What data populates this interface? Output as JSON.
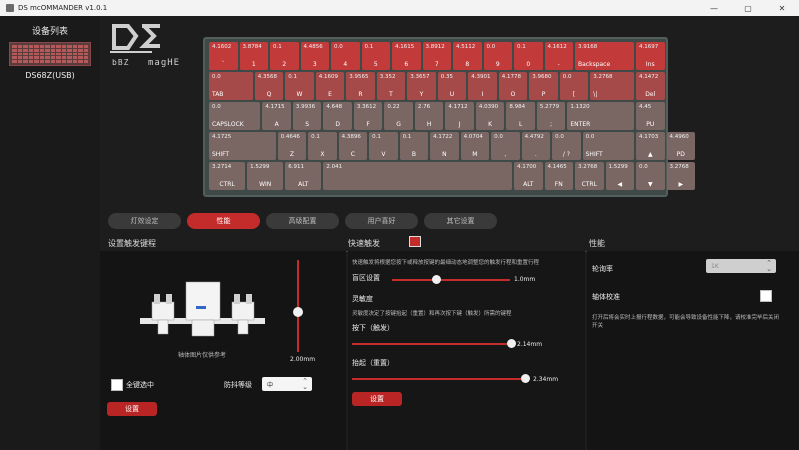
{
  "window": {
    "title": "DS mcOMMANDER v1.0.1",
    "minimize": "—",
    "maximize": "▢",
    "close": "✕"
  },
  "sidebar": {
    "heading": "设备列表",
    "device_name": "DS68Z(USB)"
  },
  "logo": {
    "small_text": "bBZ",
    "brand_text": "magHE"
  },
  "keyboard": {
    "row1": [
      {
        "v": "4.1602",
        "l": "`"
      },
      {
        "v": "3.8784",
        "l": "1"
      },
      {
        "v": "0.1",
        "l": "2"
      },
      {
        "v": "4.4856",
        "l": "3"
      },
      {
        "v": "0.0",
        "l": "4"
      },
      {
        "v": "0.1",
        "l": "5"
      },
      {
        "v": "4.1615",
        "l": "6"
      },
      {
        "v": "3.8912",
        "l": "7"
      },
      {
        "v": "4.5112",
        "l": "8"
      },
      {
        "v": "0.0",
        "l": "9"
      },
      {
        "v": "0.1",
        "l": "0"
      },
      {
        "v": "4.1612",
        "l": "-"
      },
      {
        "v": "3.9168",
        "l": "Backspace"
      },
      {
        "v": "4.1697",
        "l": "Ins"
      }
    ],
    "row2": [
      {
        "v": "0.0",
        "l": "TAB"
      },
      {
        "v": "4.3568",
        "l": "Q"
      },
      {
        "v": "0.1",
        "l": "W"
      },
      {
        "v": "4.1609",
        "l": "E"
      },
      {
        "v": "3.9565",
        "l": "R"
      },
      {
        "v": "3.352",
        "l": "T"
      },
      {
        "v": "3.3657",
        "l": "Y"
      },
      {
        "v": "0.35",
        "l": "U"
      },
      {
        "v": "4.3901",
        "l": "I"
      },
      {
        "v": "4.1778",
        "l": "O"
      },
      {
        "v": "3.9680",
        "l": "P"
      },
      {
        "v": "0.0",
        "l": "["
      },
      {
        "v": "3.2768",
        "l": "\\|"
      },
      {
        "v": "4.1472",
        "l": "Del"
      }
    ],
    "row3": [
      {
        "v": "0.0",
        "l": "CAPSLOCK"
      },
      {
        "v": "4.1715",
        "l": "A"
      },
      {
        "v": "3.9936",
        "l": "S"
      },
      {
        "v": "4.648",
        "l": "D"
      },
      {
        "v": "3.3612",
        "l": "F"
      },
      {
        "v": "0.22",
        "l": "G"
      },
      {
        "v": "2.76",
        "l": "H"
      },
      {
        "v": "4.1712",
        "l": "J"
      },
      {
        "v": "4.0390",
        "l": "K"
      },
      {
        "v": "8.984",
        "l": "L"
      },
      {
        "v": "5.2779",
        "l": ";"
      },
      {
        "v": "1.1320",
        "l": "ENTER"
      },
      {
        "v": "4.45",
        "l": "PU"
      }
    ],
    "row4": [
      {
        "v": "4.1725",
        "l": "SHIFT"
      },
      {
        "v": "0.4646",
        "l": "Z"
      },
      {
        "v": "0.1",
        "l": "X"
      },
      {
        "v": "4.3896",
        "l": "C"
      },
      {
        "v": "0.1",
        "l": "V"
      },
      {
        "v": "0.1",
        "l": "B"
      },
      {
        "v": "4.1722",
        "l": "N"
      },
      {
        "v": "4.0704",
        "l": "M"
      },
      {
        "v": "0.0",
        "l": ","
      },
      {
        "v": "4.4792",
        "l": "."
      },
      {
        "v": "0.0",
        "l": "/ ?"
      },
      {
        "v": "0.0",
        "l": "SHIFT"
      },
      {
        "v": "4.1703",
        "l": "▲"
      },
      {
        "v": "4.4960",
        "l": "PD"
      }
    ],
    "row5": [
      {
        "v": "3.2714",
        "l": "CTRL"
      },
      {
        "v": "1.5299",
        "l": "WIN"
      },
      {
        "v": "6.911",
        "l": "ALT"
      },
      {
        "v": "2.041",
        "l": ""
      },
      {
        "v": "4.1700",
        "l": "ALT"
      },
      {
        "v": "4.1465",
        "l": "FN"
      },
      {
        "v": "3.2768",
        "l": "CTRL"
      },
      {
        "v": "1.5299",
        "l": "◀"
      },
      {
        "v": "0.0",
        "l": "▼"
      },
      {
        "v": "3.2768",
        "l": "▶"
      }
    ]
  },
  "tabs": [
    {
      "label": "灯效设定"
    },
    {
      "label": "性能"
    },
    {
      "label": "高级配置"
    },
    {
      "label": "用户喜好"
    },
    {
      "label": "其它设置"
    }
  ],
  "left": {
    "title": "设置触发键程",
    "image_note": "轴体图片仅供参考",
    "travel_value": "2.00mm",
    "all_keys_label": "全键选中",
    "debounce_label": "防抖等级",
    "debounce_value": "中",
    "set_button": "设置"
  },
  "middle": {
    "title": "快速触发",
    "desc": "快速触发将根据您按下或释放按键的最细动态地调整您的触发行程和重置行程",
    "deadzone_label": "盲区设置",
    "deadzone_value": "1.0mm",
    "sensitivity_label": "灵敏度",
    "sensitivity_desc": "灵敏度决定了按键抬起（重置）和再次按下键（触发）所需的键程",
    "press_label": "按下（触发）",
    "press_value": "2.14mm",
    "release_label": "抬起（重置）",
    "release_value": "2.34mm",
    "set_button": "设置"
  },
  "right": {
    "title": "性能",
    "poll_label": "轮询率",
    "poll_value": "1K",
    "calib_label": "轴体校准",
    "calib_note": "打开后将会实时上报行程数据，可能会导致设备性能下降，请校准完毕后关闭开关"
  }
}
